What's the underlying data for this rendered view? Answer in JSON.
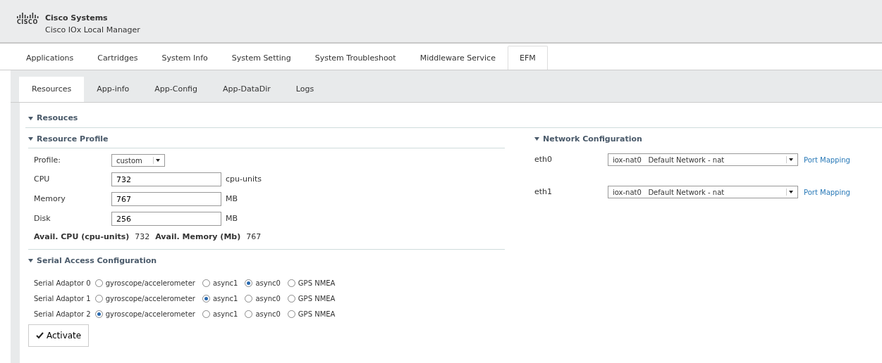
{
  "header": {
    "logo_text": "CISCO",
    "company": "Cisco Systems",
    "product": "Cisco IOx Local Manager"
  },
  "tabs": [
    {
      "label": "Applications",
      "selected": false
    },
    {
      "label": "Cartridges",
      "selected": false
    },
    {
      "label": "System Info",
      "selected": false
    },
    {
      "label": "System Setting",
      "selected": false
    },
    {
      "label": "System Troubleshoot",
      "selected": false
    },
    {
      "label": "Middleware Service",
      "selected": false
    },
    {
      "label": "EFM",
      "selected": true
    }
  ],
  "subtabs": [
    {
      "label": "Resources",
      "selected": true
    },
    {
      "label": "App-info",
      "selected": false
    },
    {
      "label": "App-Config",
      "selected": false
    },
    {
      "label": "App-DataDir",
      "selected": false
    },
    {
      "label": "Logs",
      "selected": false
    }
  ],
  "section_title": "Resouces",
  "resource_profile": {
    "title": "Resource Profile",
    "profile_label": "Profile:",
    "profile_value": "custom",
    "fields": [
      {
        "label": "CPU",
        "value": "732",
        "unit": "cpu-units"
      },
      {
        "label": "Memory",
        "value": "767",
        "unit": "MB"
      },
      {
        "label": "Disk",
        "value": "256",
        "unit": "MB"
      }
    ],
    "avail": [
      {
        "label": "Avail. CPU (cpu-units)",
        "value": "732"
      },
      {
        "label": "Avail. Memory (Mb)",
        "value": "767"
      }
    ]
  },
  "serial": {
    "title": "Serial Access Configuration",
    "adaptors": [
      {
        "label": "Serial Adaptor 0",
        "options": [
          {
            "label": "gyroscope/accelerometer",
            "selected": false
          },
          {
            "label": "async1",
            "selected": false
          },
          {
            "label": "async0",
            "selected": true
          },
          {
            "label": "GPS NMEA",
            "selected": false
          }
        ]
      },
      {
        "label": "Serial Adaptor 1",
        "options": [
          {
            "label": "gyroscope/accelerometer",
            "selected": false
          },
          {
            "label": "async1",
            "selected": true
          },
          {
            "label": "async0",
            "selected": false
          },
          {
            "label": "GPS NMEA",
            "selected": false
          }
        ]
      },
      {
        "label": "Serial Adaptor 2",
        "options": [
          {
            "label": "gyroscope/accelerometer",
            "selected": true
          },
          {
            "label": "async1",
            "selected": false
          },
          {
            "label": "async0",
            "selected": false
          },
          {
            "label": "GPS NMEA",
            "selected": false
          }
        ]
      }
    ]
  },
  "network": {
    "title": "Network Configuration",
    "interfaces": [
      {
        "label": "eth0",
        "value": "iox-nat0   Default Network - nat",
        "link": "Port Mapping"
      },
      {
        "label": "eth1",
        "value": "iox-nat0   Default Network - nat",
        "link": "Port Mapping"
      }
    ]
  },
  "activate_button": "Activate"
}
